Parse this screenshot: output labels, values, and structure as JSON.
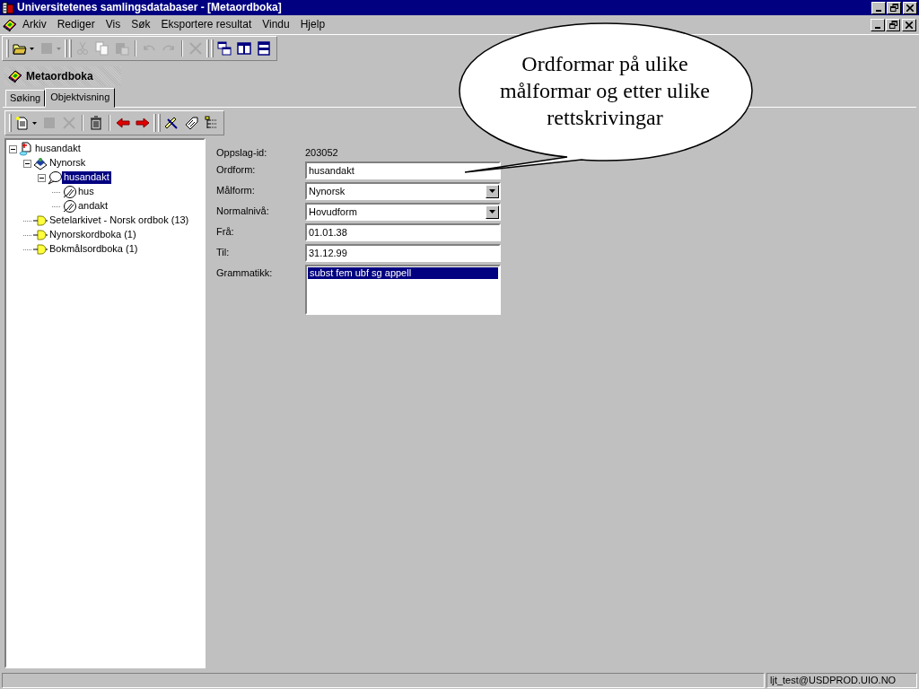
{
  "window": {
    "title": "Universitetenes samlingsdatabaser - [Metaordboka]"
  },
  "menu": [
    "Arkiv",
    "Rediger",
    "Vis",
    "Søk",
    "Eksportere resultat",
    "Vindu",
    "Hjelp"
  ],
  "toolbar": [
    [
      {
        "disabled": false,
        "dropdown": true
      },
      {
        "disabled": true,
        "dropdown": true
      }
    ],
    [
      {
        "disabled": true,
        "dropdown": false
      },
      {
        "disabled": true,
        "dropdown": false
      },
      {
        "disabled": true,
        "dropdown": false
      }
    ],
    [
      {
        "disabled": true,
        "dropdown": false
      },
      {
        "disabled": true,
        "dropdown": false
      }
    ],
    [
      {
        "disabled": true,
        "dropdown": false
      }
    ],
    [
      {
        "disabled": false,
        "dropdown": false
      },
      {
        "disabled": false,
        "dropdown": false
      },
      {
        "disabled": false,
        "dropdown": false
      }
    ]
  ],
  "child_window": {
    "title": "Metaordboka"
  },
  "tabs": [
    {
      "label": "Søking",
      "selected": false
    },
    {
      "label": "Objektvisning",
      "selected": true
    }
  ],
  "object_toolbar": [
    [
      {
        "disabled": false,
        "dropdown": true
      },
      {
        "disabled": true,
        "dropdown": false
      },
      {
        "disabled": true,
        "dropdown": false
      }
    ],
    [
      {
        "disabled": false,
        "dropdown": false
      }
    ],
    [
      {
        "disabled": false,
        "dropdown": false
      },
      {
        "disabled": false,
        "dropdown": false
      }
    ],
    [
      {
        "disabled": false,
        "dropdown": false
      },
      {
        "disabled": false,
        "dropdown": false
      },
      {
        "disabled": false,
        "dropdown": false
      }
    ]
  ],
  "tree": [
    {
      "label": "husandakt",
      "kind": "entry",
      "expanded": true,
      "selected": false,
      "children": [
        {
          "label": "Nynorsk",
          "kind": "language",
          "expanded": true,
          "selected": false,
          "children": [
            {
              "label": "husandakt",
              "kind": "wordform",
              "expanded": true,
              "selected": true,
              "children": [
                {
                  "label": "hus",
                  "kind": "part",
                  "selected": false
                },
                {
                  "label": "andakt",
                  "kind": "part",
                  "selected": false
                }
              ]
            }
          ]
        },
        {
          "label": "Setelarkivet - Norsk ordbok (13)",
          "kind": "source",
          "selected": false
        },
        {
          "label": "Nynorskordboka (1)",
          "kind": "source",
          "selected": false
        },
        {
          "label": "Bokmålsordboka (1)",
          "kind": "source",
          "selected": false
        }
      ]
    }
  ],
  "form": [
    {
      "label": "Oppslag-id:",
      "kind": "static",
      "value": "203052"
    },
    {
      "label": "Ordform:",
      "kind": "text",
      "value": "husandakt"
    },
    {
      "label": "Målform:",
      "kind": "select",
      "value": "Nynorsk"
    },
    {
      "label": "Normalnivå:",
      "kind": "select",
      "value": "Hovudform"
    },
    {
      "label": "Frå:",
      "kind": "text",
      "value": "01.01.38"
    },
    {
      "label": "Til:",
      "kind": "text",
      "value": "31.12.99"
    },
    {
      "label": "Grammatikk:",
      "kind": "list",
      "items": [
        {
          "text": "subst fem ubf sg appell",
          "selected": true
        }
      ]
    }
  ],
  "callout": {
    "text": "Ordformar på ulike målformar og etter ulike rettskrivingar"
  },
  "status_bar": {
    "user": "ljt_test@USDPROD.UIO.NO"
  }
}
